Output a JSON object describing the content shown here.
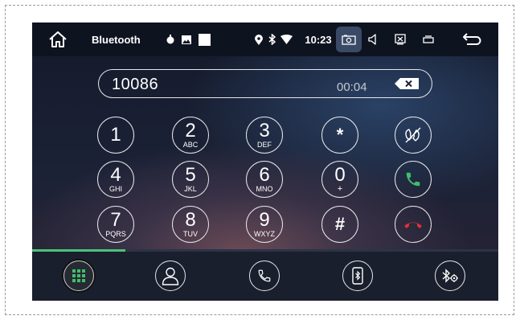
{
  "status_bar": {
    "app_title": "Bluetooth",
    "time": "10:23",
    "icons": [
      "home-icon",
      "notification-dot-icon",
      "image-icon",
      "white-square-icon",
      "location-icon",
      "bluetooth-icon",
      "wifi-icon",
      "camera-icon",
      "volume-icon",
      "screen-mirror-icon",
      "recent-apps-icon",
      "back-icon"
    ]
  },
  "dialer": {
    "number": "10086",
    "call_timer": "00:04",
    "keys": [
      {
        "digit": "1",
        "letters": ""
      },
      {
        "digit": "2",
        "letters": "ABC"
      },
      {
        "digit": "3",
        "letters": "DEF"
      },
      {
        "digit": "4",
        "letters": "GHI"
      },
      {
        "digit": "5",
        "letters": "JKL"
      },
      {
        "digit": "6",
        "letters": "MNO"
      },
      {
        "digit": "7",
        "letters": "PQRS"
      },
      {
        "digit": "8",
        "letters": "TUV"
      },
      {
        "digit": "9",
        "letters": "WXYZ"
      }
    ],
    "special_keys": {
      "star": "*",
      "zero": "0",
      "zero_sub": "+",
      "hash": "#"
    },
    "call_progress": 0.2
  },
  "bottom_nav": {
    "items": [
      "keypad-icon",
      "contacts-icon",
      "call-log-icon",
      "phone-bluetooth-icon",
      "bluetooth-settings-icon"
    ],
    "active": "keypad-icon"
  },
  "colors": {
    "answer": "#3fbf6a",
    "hangup": "#e0323a",
    "accent_green": "#4cc27a",
    "status_bar_bg": "#0e1320",
    "nav_bar_bg": "#1a1f2d"
  }
}
